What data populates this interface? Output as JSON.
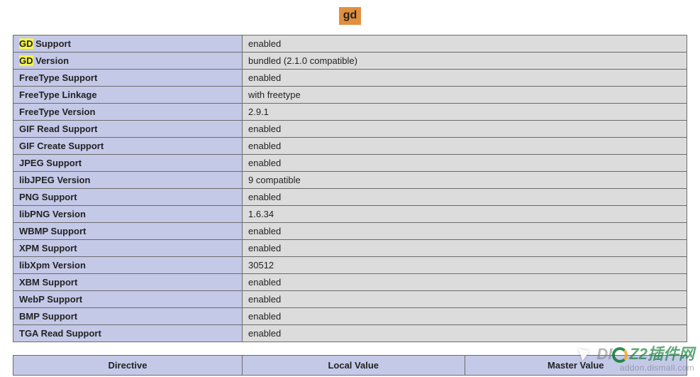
{
  "section": {
    "title": "gd"
  },
  "rows": [
    {
      "key_prefix_hl": "GD",
      "key_rest": " Support",
      "value": "enabled"
    },
    {
      "key_prefix_hl": "GD",
      "key_rest": " Version",
      "value": "bundled (2.1.0 compatible)"
    },
    {
      "key_prefix_hl": "",
      "key_rest": "FreeType Support",
      "value": "enabled"
    },
    {
      "key_prefix_hl": "",
      "key_rest": "FreeType Linkage",
      "value": "with freetype"
    },
    {
      "key_prefix_hl": "",
      "key_rest": "FreeType Version",
      "value": "2.9.1"
    },
    {
      "key_prefix_hl": "",
      "key_rest": "GIF Read Support",
      "value": "enabled"
    },
    {
      "key_prefix_hl": "",
      "key_rest": "GIF Create Support",
      "value": "enabled"
    },
    {
      "key_prefix_hl": "",
      "key_rest": "JPEG Support",
      "value": "enabled"
    },
    {
      "key_prefix_hl": "",
      "key_rest": "libJPEG Version",
      "value": "9 compatible"
    },
    {
      "key_prefix_hl": "",
      "key_rest": "PNG Support",
      "value": "enabled"
    },
    {
      "key_prefix_hl": "",
      "key_rest": "libPNG Version",
      "value": "1.6.34"
    },
    {
      "key_prefix_hl": "",
      "key_rest": "WBMP Support",
      "value": "enabled"
    },
    {
      "key_prefix_hl": "",
      "key_rest": "XPM Support",
      "value": "enabled"
    },
    {
      "key_prefix_hl": "",
      "key_rest": "libXpm Version",
      "value": "30512"
    },
    {
      "key_prefix_hl": "",
      "key_rest": "XBM Support",
      "value": "enabled"
    },
    {
      "key_prefix_hl": "",
      "key_rest": "WebP Support",
      "value": "enabled"
    },
    {
      "key_prefix_hl": "",
      "key_rest": "BMP Support",
      "value": "enabled"
    },
    {
      "key_prefix_hl": "",
      "key_rest": "TGA Read Support",
      "value": "enabled"
    }
  ],
  "directive_headers": {
    "col1": "Directive",
    "col2": "Local Value",
    "col3": "Master Value"
  },
  "watermark": {
    "main_left": "DI",
    "main_right": "Z2插件网",
    "sub": "addon.dismall.com"
  }
}
